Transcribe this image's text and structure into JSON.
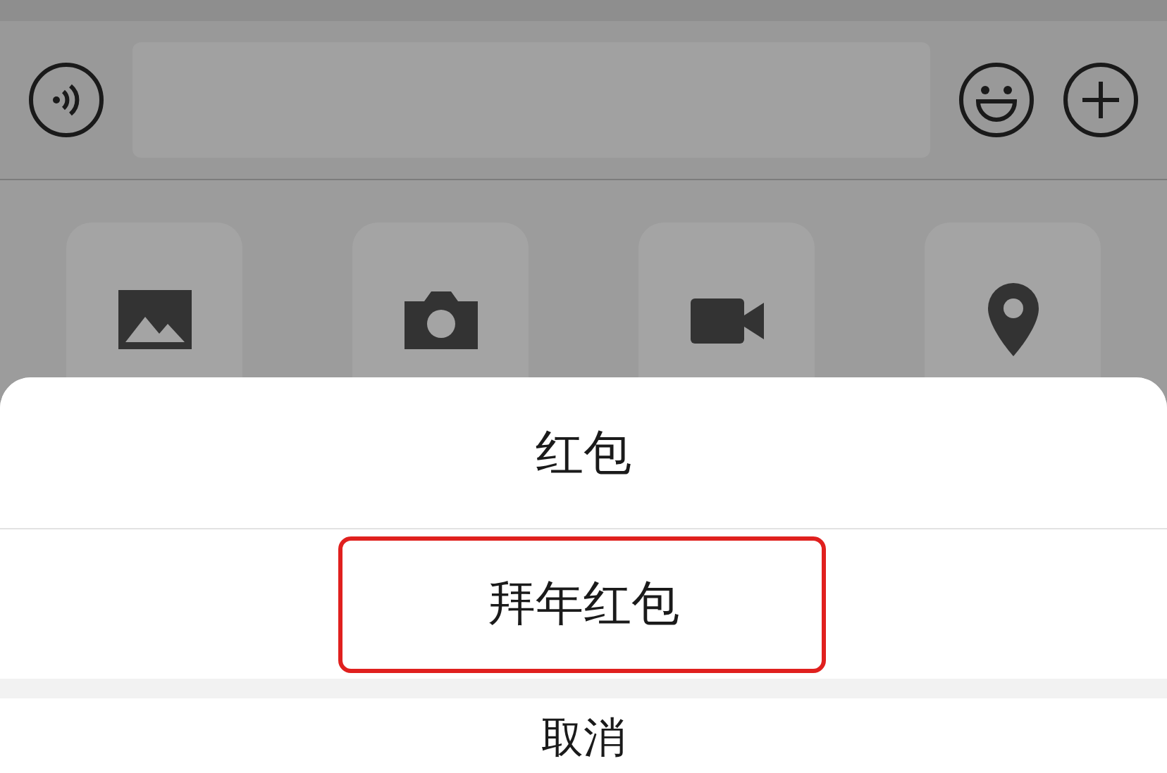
{
  "action_sheet": {
    "options": [
      {
        "label": "红包",
        "highlighted": false
      },
      {
        "label": "拜年红包",
        "highlighted": true
      }
    ],
    "cancel": "取消"
  }
}
